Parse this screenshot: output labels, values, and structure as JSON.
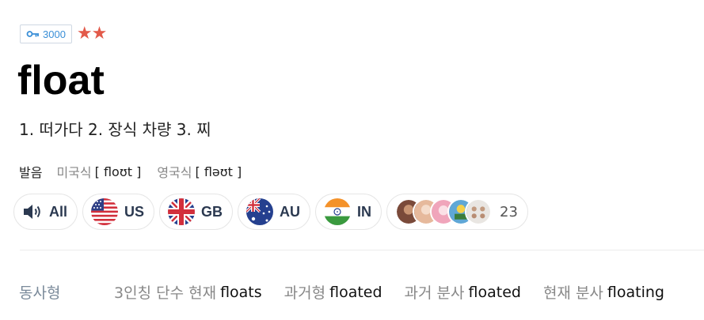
{
  "level": {
    "value": "3000",
    "stars": "★★"
  },
  "word": "float",
  "meanings": "1. 떠가다 2. 장식 차량 3. 찌",
  "pronunciation": {
    "label": "발음",
    "us_label": "미국식",
    "us_ipa": "[ floʊt ]",
    "uk_label": "영국식",
    "uk_ipa": "[ fləʊt ]"
  },
  "audio_buttons": [
    {
      "code": "All",
      "icon": "speaker-icon"
    },
    {
      "code": "US",
      "icon": "us-flag-icon"
    },
    {
      "code": "GB",
      "icon": "gb-flag-icon"
    },
    {
      "code": "AU",
      "icon": "au-flag-icon"
    },
    {
      "code": "IN",
      "icon": "in-flag-icon"
    }
  ],
  "community": {
    "count": "23"
  },
  "verb_forms": {
    "category": "동사형",
    "items": [
      {
        "label": "3인칭 단수 현재",
        "value": "floats"
      },
      {
        "label": "과거형",
        "value": "floated"
      },
      {
        "label": "과거 분사",
        "value": "floated"
      },
      {
        "label": "현재 분사",
        "value": "floating"
      }
    ]
  },
  "colors": {
    "accent": "#3a8fd7",
    "stars": "#e25a4a",
    "code_text": "#2b3950"
  }
}
